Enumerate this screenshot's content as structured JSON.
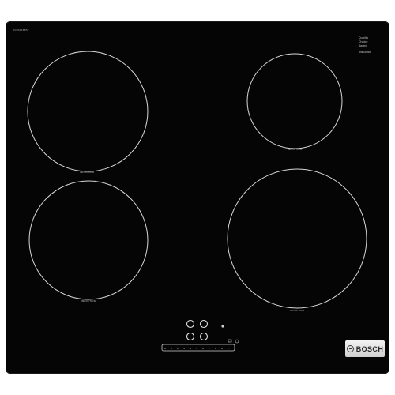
{
  "product": {
    "brand_name": "BOSCH",
    "brand_logo": "bosch-armature-logo",
    "model_label": "PUE611BB5E",
    "badge_lines": [
      "Quality",
      "Choice",
      "Award"
    ],
    "badge_sub": "Induction"
  },
  "zones": [
    {
      "id": "front-left-top",
      "label": "INDUCTION"
    },
    {
      "id": "rear-right",
      "label": "INDUCTION"
    },
    {
      "id": "front-left-bottom",
      "label": "INDUCTION"
    },
    {
      "id": "front-right",
      "label": "INDUCTION"
    }
  ],
  "controls": {
    "selector_icon": "zone-selector-icon",
    "indicator_icon": "indicator-dot-icon",
    "bar_items": [
      "0",
      "1",
      "2",
      "3",
      "4",
      "5",
      "6",
      "7",
      "8",
      "9",
      "P"
    ],
    "lock_icon": "lock-icon",
    "timer_icon": "timer-icon"
  }
}
